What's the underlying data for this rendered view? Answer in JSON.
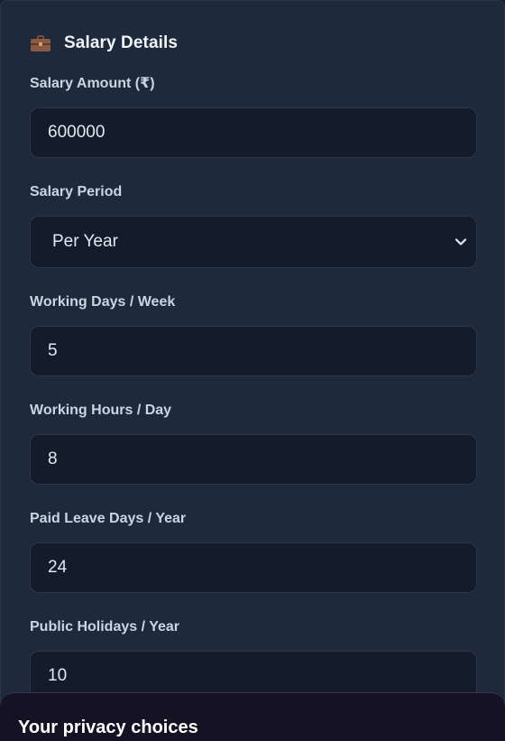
{
  "card": {
    "icon": "briefcase-icon",
    "title": "Salary Details"
  },
  "fields": {
    "salary_amount": {
      "label": "Salary Amount (₹)",
      "value": "600000"
    },
    "salary_period": {
      "label": "Salary Period",
      "value": "Per Year"
    },
    "working_days": {
      "label": "Working Days / Week",
      "value": "5"
    },
    "working_hours": {
      "label": "Working Hours / Day",
      "value": "8"
    },
    "paid_leave": {
      "label": "Paid Leave Days / Year",
      "value": "24"
    },
    "public_holidays": {
      "label": "Public Holidays / Year",
      "value": "10"
    }
  },
  "privacy": {
    "title": "Your privacy choices"
  },
  "colors": {
    "background": "#1e293b",
    "input_bg": "#141c2b",
    "label": "#cbd5e1",
    "text": "#e2e8f0",
    "privacy_bg": "#151224"
  }
}
